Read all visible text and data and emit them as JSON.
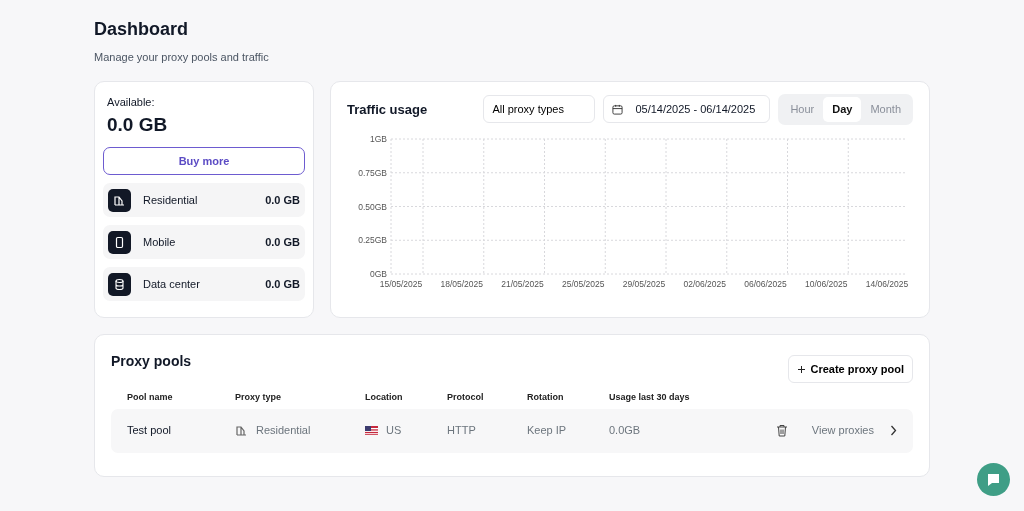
{
  "header": {
    "title": "Dashboard",
    "subtitle": "Manage your proxy pools and traffic"
  },
  "balance": {
    "label": "Available:",
    "amount": "0.0 GB",
    "button": "Buy more",
    "types": [
      {
        "kind": "residential",
        "name": "Residential",
        "amount": "0.0 GB"
      },
      {
        "kind": "mobile",
        "name": "Mobile",
        "amount": "0.0 GB"
      },
      {
        "kind": "datacenter",
        "name": "Data center",
        "amount": "0.0 GB"
      }
    ]
  },
  "traffic": {
    "title": "Traffic usage",
    "filter": "All proxy types",
    "date_range": "05/14/2025 - 06/14/2025",
    "periods": [
      {
        "label": "Hour",
        "selected": false
      },
      {
        "label": "Day",
        "selected": true
      },
      {
        "label": "Month",
        "selected": false
      }
    ],
    "chart_data": {
      "type": "line",
      "grid": true,
      "categories": [
        "15/05/2025",
        "18/05/2025",
        "21/05/2025",
        "25/05/2025",
        "29/05/2025",
        "02/06/2025",
        "06/06/2025",
        "10/06/2025",
        "14/06/2025"
      ],
      "ylim": [
        0,
        1
      ],
      "yticks": [
        {
          "value": 0,
          "label": "0GB"
        },
        {
          "value": 0.25,
          "label": "0.25GB"
        },
        {
          "value": 0.5,
          "label": "0.50GB"
        },
        {
          "value": 0.75,
          "label": "0.75GB"
        },
        {
          "value": 1,
          "label": "1GB"
        }
      ]
    }
  },
  "pools": {
    "title": "Proxy pools",
    "create_button": "Create proxy pool",
    "columns": [
      "Pool name",
      "Proxy type",
      "Location",
      "Protocol",
      "Rotation",
      "Usage last 30 days"
    ],
    "rows": [
      {
        "name": "Test pool",
        "type": "Residential",
        "location": "US",
        "protocol": "HTTP",
        "rotation": "Keep IP",
        "usage": "0.0GB",
        "action": "View proxies"
      }
    ]
  }
}
